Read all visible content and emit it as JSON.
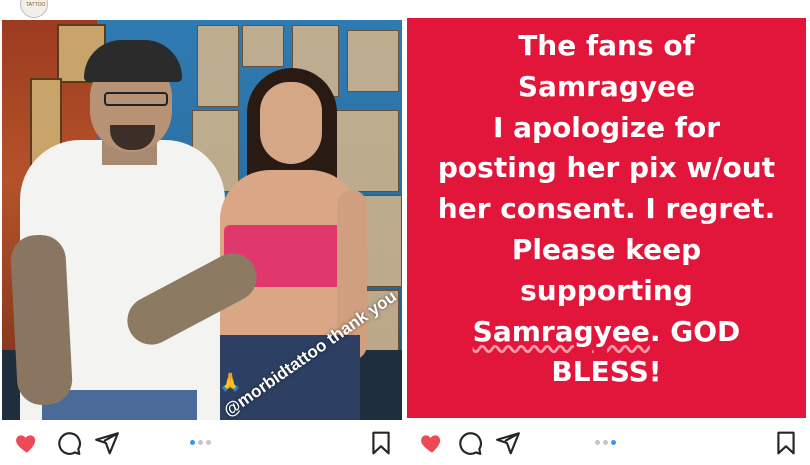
{
  "left_post": {
    "photo_caption": "@morbidtattoo thank you",
    "caption_emoji": "🙏",
    "actions": {
      "like": "heart-icon-filled",
      "comment": "comment-icon",
      "share": "share-icon",
      "save": "bookmark-icon"
    },
    "carousel": {
      "count": 3,
      "active": 1
    }
  },
  "right_post": {
    "message_lines": [
      "The fans of",
      "Samragyee",
      "I apologize for",
      "posting her pix w/out",
      "her consent. I regret.",
      "Please keep",
      "supporting"
    ],
    "message_last_line_name": "Samragyee",
    "message_last_line_rest": ". GOD",
    "message_final_line": "BLESS!",
    "actions": {
      "like": "heart-icon-filled",
      "comment": "comment-icon",
      "share": "share-icon",
      "save": "bookmark-icon"
    },
    "carousel": {
      "count": 3,
      "active": 3
    }
  },
  "colors": {
    "like_red": "#ed4956",
    "card_red": "#e2153a",
    "dot_active": "#3897f0",
    "dot_inactive": "#c7c7c7",
    "icon_dark": "#262626"
  }
}
